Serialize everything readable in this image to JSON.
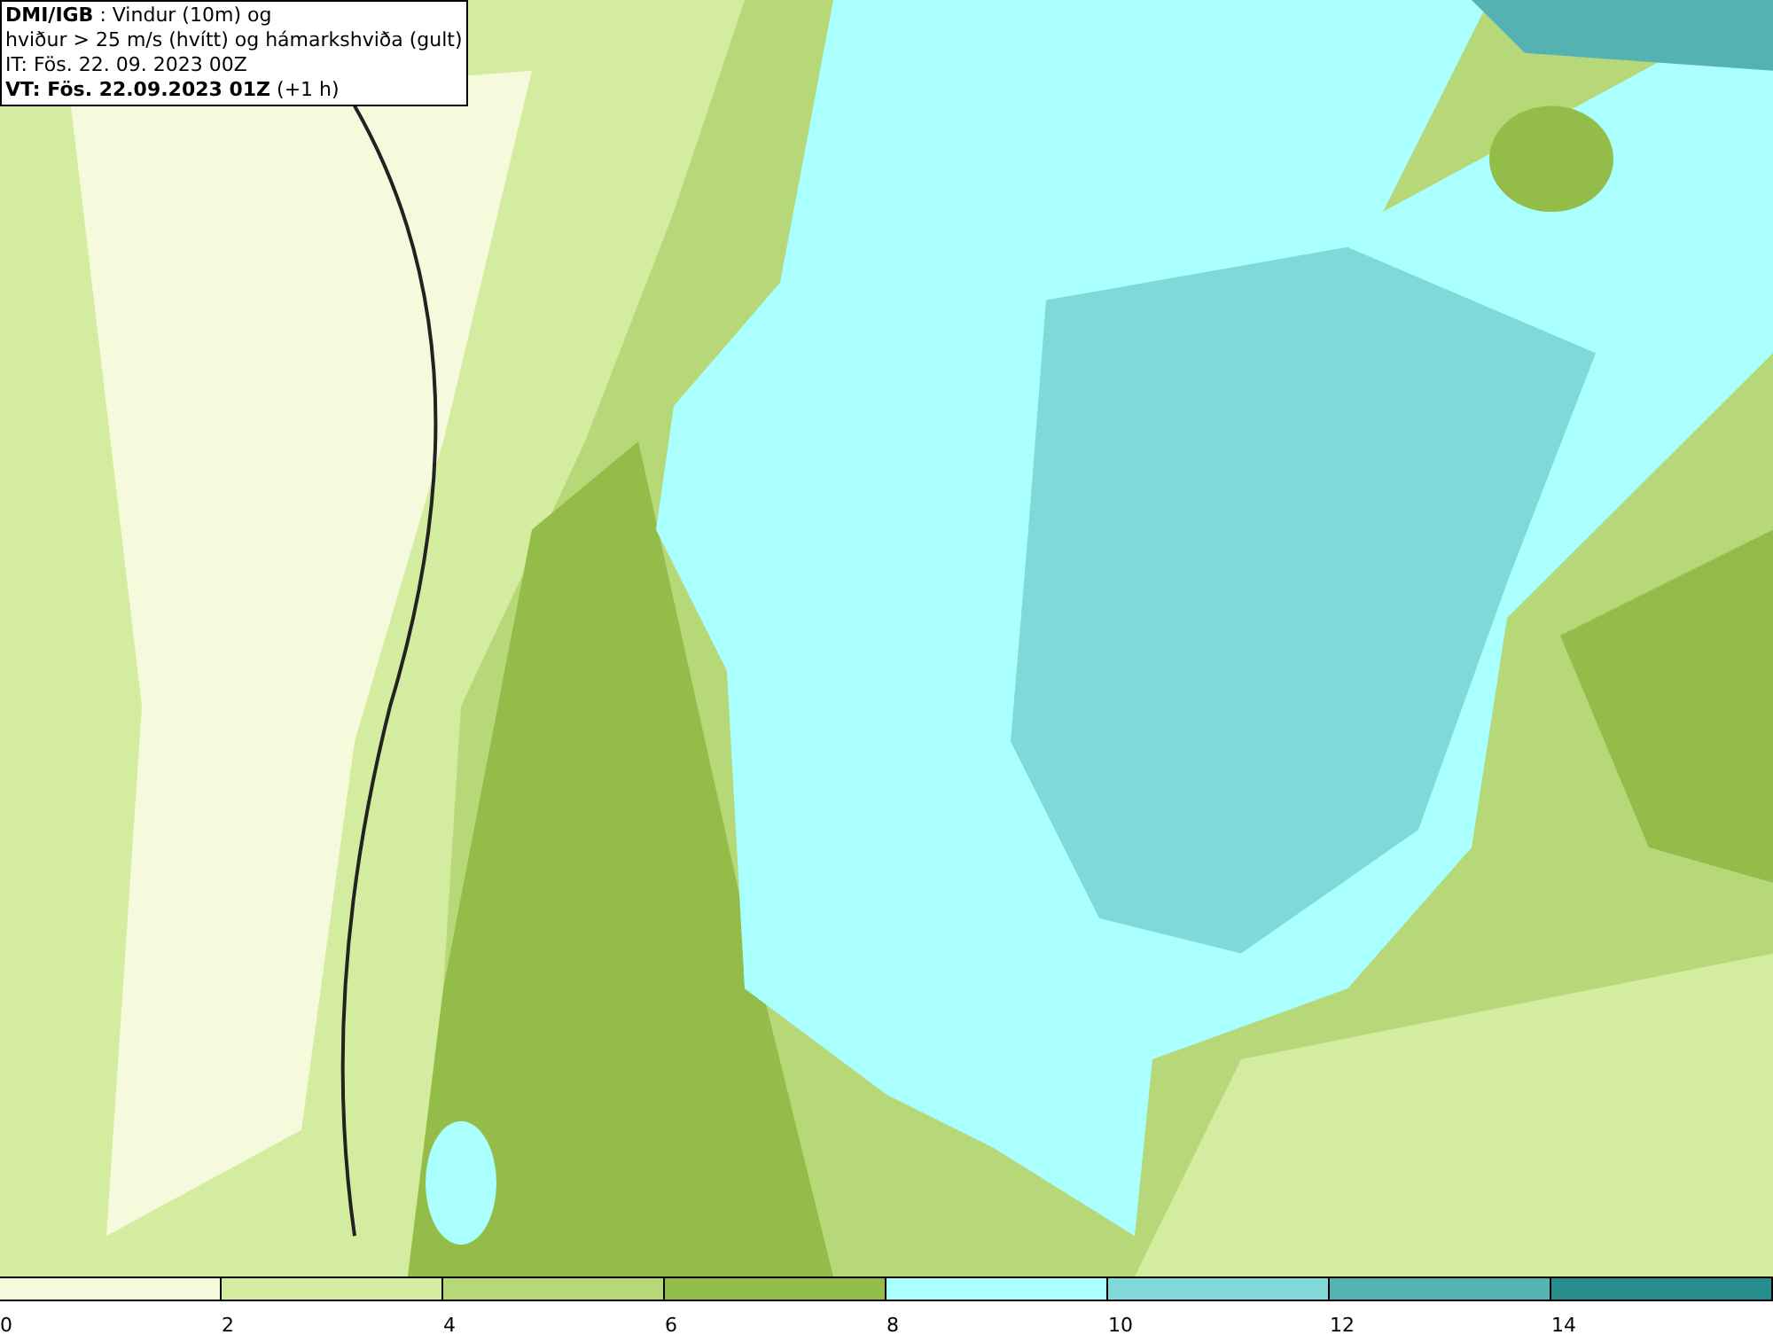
{
  "header": {
    "lines": [
      "**DMI/IGB** : Vindur (10m) og",
      "hviður > 25 m/s (hvítt) og hámarkshviða (gult)",
      "IT: Fös. 22. 09. 2023 00Z",
      "**VT: Fös. 22.09.2023 01Z** (+1 h)"
    ]
  },
  "legend": [
    {
      "label": "0",
      "color": "#f5fadc"
    },
    {
      "label": "2",
      "color": "#d4eca0"
    },
    {
      "label": "4",
      "color": "#b6d878"
    },
    {
      "label": "6",
      "color": "#93bd48"
    },
    {
      "label": "8",
      "color": "#aaffff"
    },
    {
      "label": "10",
      "color": "#80d8d8"
    },
    {
      "label": "12",
      "color": "#55b2b2"
    },
    {
      "label": "14",
      "color": "#268c8c"
    }
  ]
}
